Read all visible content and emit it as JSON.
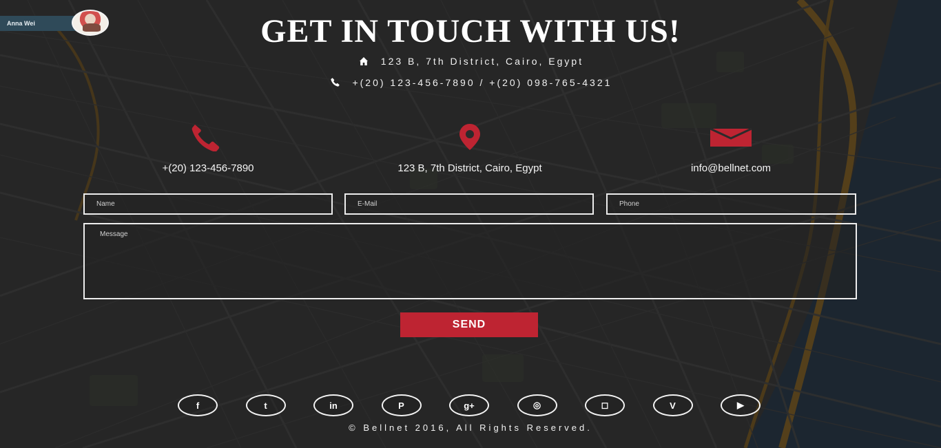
{
  "page": {
    "title": "GET IN TOUCH WITH US!",
    "address_line": "123 B, 7th District, Cairo, Egypt",
    "phone_line": "+(20) 123-456-7890 / +(20) 098-765-4321",
    "footer": "© Bellnet 2016, All Rights Reserved."
  },
  "user": {
    "name": "Anna Wei",
    "avatar_icon": "profile-avatar"
  },
  "contacts": [
    {
      "icon": "phone-icon",
      "text": "+(20) 123-456-7890"
    },
    {
      "icon": "location-pin-icon",
      "text": "123 B, 7th District, Cairo, Egypt"
    },
    {
      "icon": "email-icon",
      "text": "info@bellnet.com"
    }
  ],
  "form": {
    "name_placeholder": "Name",
    "email_placeholder": "E-Mail",
    "phone_placeholder": "Phone",
    "message_placeholder": "Message",
    "send_label": "SEND"
  },
  "social": [
    {
      "name": "facebook-icon",
      "glyph": "f"
    },
    {
      "name": "twitter-icon",
      "glyph": "t"
    },
    {
      "name": "linkedin-icon",
      "glyph": "in"
    },
    {
      "name": "pinterest-icon",
      "glyph": "P"
    },
    {
      "name": "google-plus-icon",
      "glyph": "g+"
    },
    {
      "name": "dribbble-icon",
      "glyph": "◎"
    },
    {
      "name": "instagram-icon",
      "glyph": "◻"
    },
    {
      "name": "vimeo-icon",
      "glyph": "V"
    },
    {
      "name": "youtube-icon",
      "glyph": "▶"
    }
  ],
  "colors": {
    "accent": "#be2432",
    "background": "#272727",
    "water": "#1e2a36",
    "road": "#664a1b"
  }
}
